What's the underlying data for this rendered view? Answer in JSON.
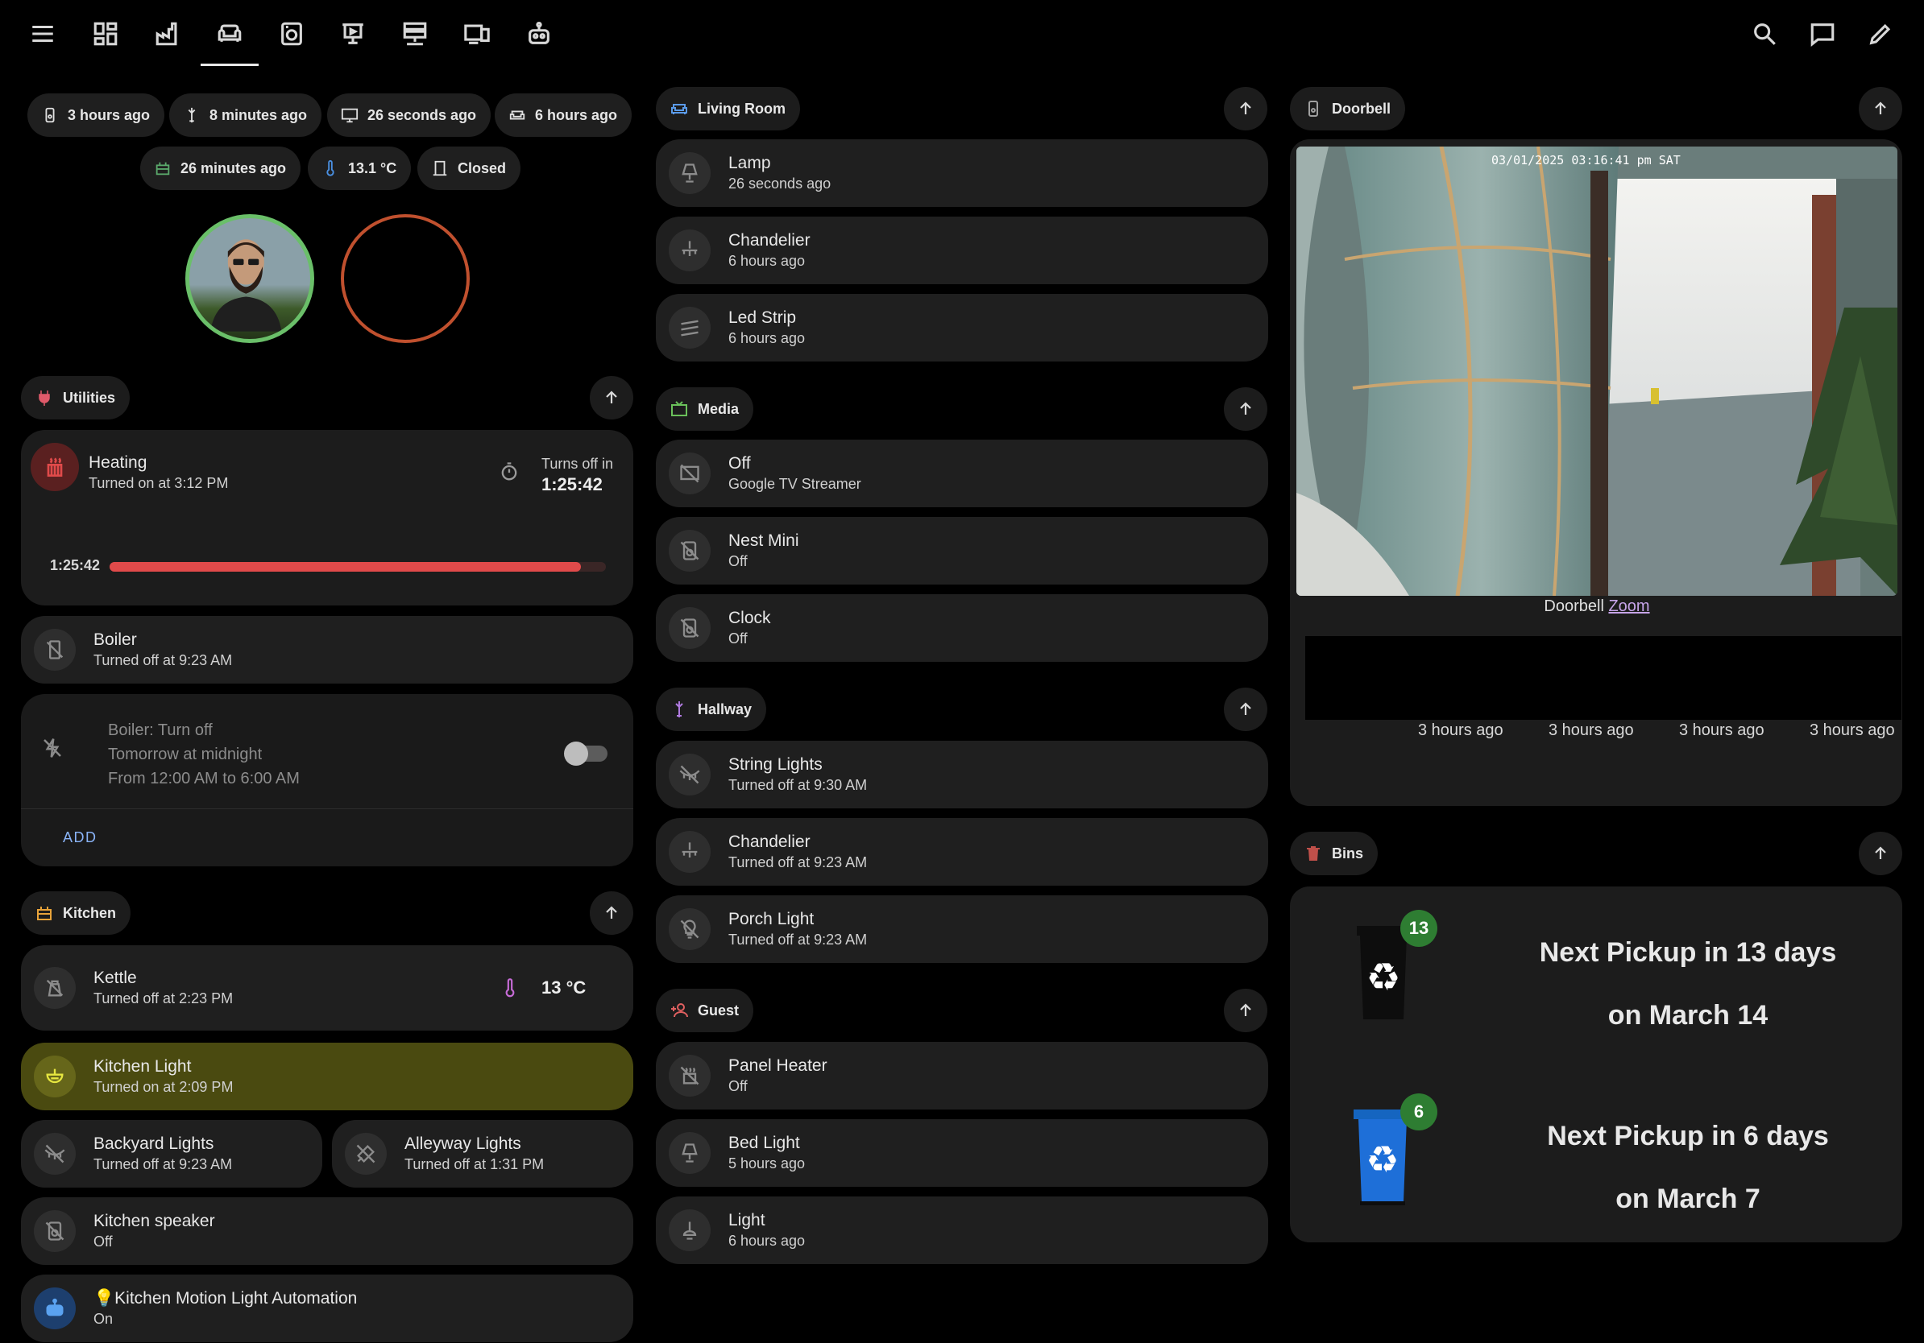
{
  "nav": {
    "icons": [
      "menu-icon",
      "dashboard-icon",
      "factory-icon",
      "sofa-icon",
      "washing-machine-icon",
      "presentation-icon",
      "server-icon",
      "devices-icon",
      "robot-icon"
    ],
    "right_icons": [
      "search-icon",
      "assist-icon",
      "edit-icon"
    ]
  },
  "badges": {
    "row1": [
      {
        "icon": "doorbell-icon",
        "label": "3 hours ago"
      },
      {
        "icon": "hallway-lamp-icon",
        "label": "8 minutes ago"
      },
      {
        "icon": "monitor-icon",
        "label": "26 seconds ago"
      },
      {
        "icon": "sofa-icon",
        "label": "6 hours ago"
      }
    ],
    "row2": [
      {
        "icon": "kitchen-icon",
        "label": "26 minutes ago"
      },
      {
        "icon": "thermometer-icon",
        "label": "13.1 °C"
      },
      {
        "icon": "door-icon",
        "label": "Closed"
      }
    ]
  },
  "utilities": {
    "title": "Utilities",
    "heating": {
      "name": "Heating",
      "state": "Turned on at 3:12 PM",
      "timer_label": "Turns off in",
      "timer_value": "1:25:42",
      "progress_label": "1:25:42",
      "progress_fraction": 0.95
    },
    "boiler": {
      "name": "Boiler",
      "state": "Turned off at 9:23 AM"
    },
    "schedule": {
      "line1": "Boiler: Turn off",
      "line2": "Tomorrow at midnight",
      "line3": "From 12:00 AM to 6:00 AM",
      "add_label": "ADD"
    }
  },
  "kitchen": {
    "title": "Kitchen",
    "kettle": {
      "name": "Kettle",
      "state": "Turned off at 2:23 PM",
      "temp": "13 °C"
    },
    "light": {
      "name": "Kitchen Light",
      "state": "Turned on at 2:09 PM"
    },
    "backyard": {
      "name": "Backyard Lights",
      "state": "Turned off at 9:23 AM"
    },
    "alleyway": {
      "name": "Alleyway Lights",
      "state": "Turned off at 1:31 PM"
    },
    "speaker": {
      "name": "Kitchen speaker",
      "state": "Off"
    },
    "automation": {
      "name": "💡Kitchen Motion Light Automation",
      "state": "On"
    }
  },
  "living_room": {
    "title": "Living Room",
    "items": [
      {
        "name": "Lamp",
        "state": "26 seconds ago"
      },
      {
        "name": "Chandelier",
        "state": "6 hours ago"
      },
      {
        "name": "Led Strip",
        "state": "6 hours ago"
      }
    ]
  },
  "media": {
    "title": "Media",
    "items": [
      {
        "name": "Off",
        "state": "Google TV Streamer"
      },
      {
        "name": "Nest Mini",
        "state": "Off"
      },
      {
        "name": "Clock",
        "state": "Off"
      }
    ]
  },
  "hallway": {
    "title": "Hallway",
    "items": [
      {
        "name": "String Lights",
        "state": "Turned off at 9:30 AM"
      },
      {
        "name": "Chandelier",
        "state": "Turned off at 9:23 AM"
      },
      {
        "name": "Porch Light",
        "state": "Turned off at 9:23 AM"
      }
    ]
  },
  "guest": {
    "title": "Guest",
    "items": [
      {
        "name": "Panel Heater",
        "state": "Off"
      },
      {
        "name": "Bed Light",
        "state": "5 hours ago"
      },
      {
        "name": "Light",
        "state": "6 hours ago"
      }
    ]
  },
  "doorbell": {
    "title": "Doorbell",
    "timestamp": "03/01/2025 03:16:41 pm SAT",
    "caption": "Doorbell",
    "zoom_link": "Zoom",
    "events": [
      "3 hours ago",
      "3 hours ago",
      "3 hours ago",
      "3 hours ago"
    ]
  },
  "bins": {
    "title": "Bins",
    "items": [
      {
        "count": "13",
        "line1": "Next Pickup in 13 days",
        "line2": "on March 14",
        "color": "#111111"
      },
      {
        "count": "6",
        "line1": "Next Pickup in 6 days",
        "line2": "on March 7",
        "color": "#1565c0"
      }
    ]
  },
  "colors": {
    "heating_accent": "#e04a4a",
    "kitchen_light_bg": "#4a4a10",
    "avatar_ring_green": "#6abf69",
    "avatar_ring_red": "#c0502e",
    "bin_badge": "#2e7d32"
  }
}
